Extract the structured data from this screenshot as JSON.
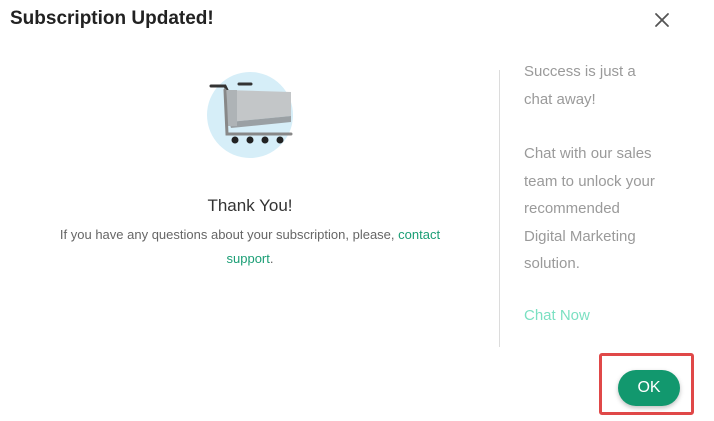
{
  "dialog": {
    "title": "Subscription Updated!",
    "close_icon": "close-icon"
  },
  "left": {
    "illustration_icon": "shopping-cart-icon",
    "thank_you": "Thank You!",
    "help_prefix": "If you have any questions about your subscription, please, ",
    "help_link": "contact support",
    "help_suffix": "."
  },
  "right": {
    "lines1": [
      "Success is just a",
      "chat away!"
    ],
    "lines2": [
      "Chat with our sales",
      "team to unlock your",
      "recommended",
      "Digital Marketing",
      "solution."
    ],
    "chat_now": "Chat Now"
  },
  "footer": {
    "ok_label": "OK"
  },
  "colors": {
    "accent": "#12986e",
    "link": "#1a9e75",
    "chat_now": "#7be0c2",
    "highlight": "#e04848"
  }
}
